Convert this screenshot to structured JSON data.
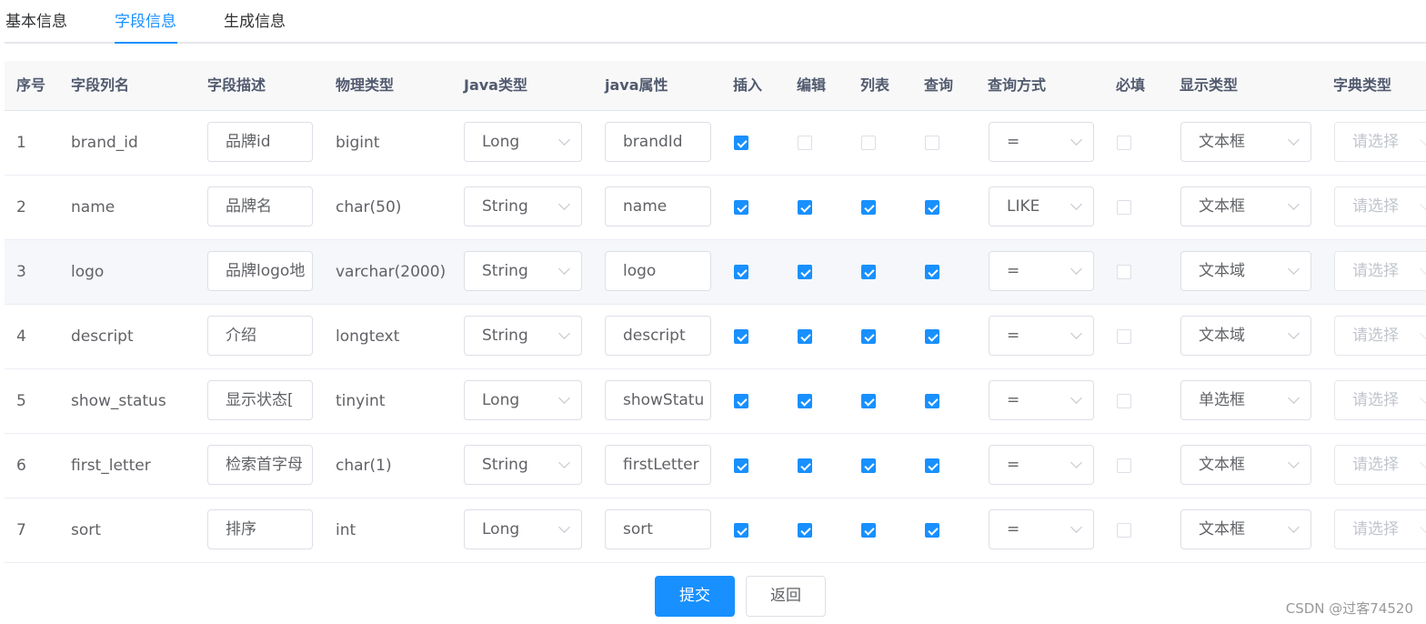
{
  "tabs": [
    "基本信息",
    "字段信息",
    "生成信息"
  ],
  "active_tab": "字段信息",
  "columns": [
    "序号",
    "字段列名",
    "字段描述",
    "物理类型",
    "Java类型",
    "java属性",
    "插入",
    "编辑",
    "列表",
    "查询",
    "查询方式",
    "必填",
    "显示类型",
    "字典类型"
  ],
  "rows": [
    {
      "index": "1",
      "column": "brand_id",
      "desc": "品牌id",
      "phys": "bigint",
      "java_type": "Long",
      "java_attr": "brandId",
      "insert": true,
      "edit": false,
      "list": false,
      "query": false,
      "query_type": "=",
      "required": false,
      "display": "文本框",
      "dict": "请选择"
    },
    {
      "index": "2",
      "column": "name",
      "desc": "品牌名",
      "phys": "char(50)",
      "java_type": "String",
      "java_attr": "name",
      "insert": true,
      "edit": true,
      "list": true,
      "query": true,
      "query_type": "LIKE",
      "required": false,
      "display": "文本框",
      "dict": "请选择"
    },
    {
      "index": "3",
      "column": "logo",
      "desc": "品牌logo地",
      "phys": "varchar(2000)",
      "java_type": "String",
      "java_attr": "logo",
      "insert": true,
      "edit": true,
      "list": true,
      "query": true,
      "query_type": "=",
      "required": false,
      "display": "文本域",
      "dict": "请选择"
    },
    {
      "index": "4",
      "column": "descript",
      "desc": "介绍",
      "phys": "longtext",
      "java_type": "String",
      "java_attr": "descript",
      "insert": true,
      "edit": true,
      "list": true,
      "query": true,
      "query_type": "=",
      "required": false,
      "display": "文本域",
      "dict": "请选择"
    },
    {
      "index": "5",
      "column": "show_status",
      "desc": "显示状态[",
      "phys": "tinyint",
      "java_type": "Long",
      "java_attr": "showStatu",
      "insert": true,
      "edit": true,
      "list": true,
      "query": true,
      "query_type": "=",
      "required": false,
      "display": "单选框",
      "dict": "请选择"
    },
    {
      "index": "6",
      "column": "first_letter",
      "desc": "检索首字母",
      "phys": "char(1)",
      "java_type": "String",
      "java_attr": "firstLetter",
      "insert": true,
      "edit": true,
      "list": true,
      "query": true,
      "query_type": "=",
      "required": false,
      "display": "文本框",
      "dict": "请选择"
    },
    {
      "index": "7",
      "column": "sort",
      "desc": "排序",
      "phys": "int",
      "java_type": "Long",
      "java_attr": "sort",
      "insert": true,
      "edit": true,
      "list": true,
      "query": true,
      "query_type": "=",
      "required": false,
      "display": "文本框",
      "dict": "请选择"
    }
  ],
  "buttons": {
    "submit": "提交",
    "back": "返回"
  },
  "watermark": "CSDN @过客74520",
  "colors": {
    "accent": "#1890ff",
    "header_bg": "#f8f8f9",
    "border": "#dcdfe6"
  }
}
